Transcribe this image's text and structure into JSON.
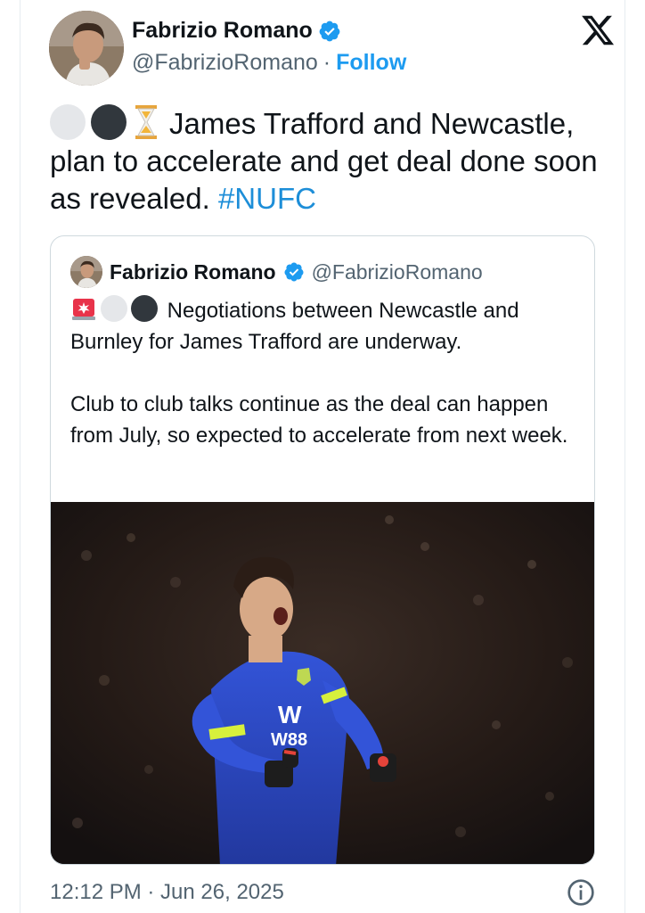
{
  "author": {
    "display_name": "Fabrizio Romano",
    "handle": "@FabrizioRomano",
    "separator": "·",
    "follow_label": "Follow"
  },
  "tweet": {
    "text_main": "James Trafford and Newcastle, plan to accelerate and get deal done soon as revealed. ",
    "hashtag": "#NUFC",
    "emojis": [
      "white-circle",
      "black-circle",
      "hourglass"
    ]
  },
  "quote": {
    "display_name": "Fabrizio Romano",
    "handle": "@FabrizioRomano",
    "emojis": [
      "siren",
      "white-circle",
      "black-circle"
    ],
    "paragraph_1": "Negotiations between Newcastle and Burnley for James Trafford are underway.",
    "paragraph_2": "Club to club talks continue as the deal can happen from July, so expected to accelerate from next week.",
    "photo": {
      "subject": "goalkeeper celebrating in blue Burnley kit",
      "shirt_text": "W88"
    }
  },
  "footer": {
    "timestamp": "12:12 PM · Jun 26, 2025"
  },
  "colors": {
    "accent": "#1d9bf0",
    "secondary_text": "#536471",
    "border": "#cfd9de",
    "kit_blue": "#2f4fd1",
    "kit_yellow": "#d7f03c"
  },
  "icons": [
    "verified-badge-icon",
    "x-logo-icon",
    "info-icon"
  ]
}
